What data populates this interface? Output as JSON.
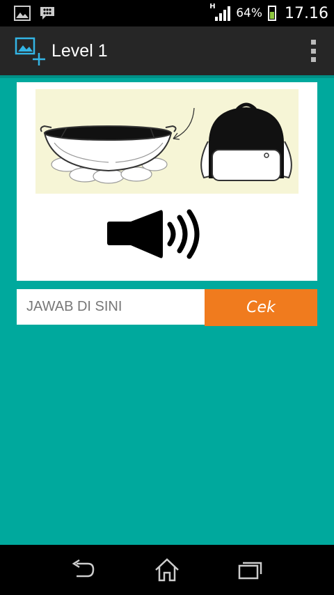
{
  "status_bar": {
    "network_type": "H",
    "battery_percent": "64%",
    "battery_level": 0.64,
    "time": "17.16"
  },
  "action_bar": {
    "title": "Level 1",
    "icon": "add-image-icon"
  },
  "puzzle": {
    "picture_icons": [
      "wok-icon",
      "backpack-icon"
    ],
    "audio_icon": "speaker-icon"
  },
  "answer": {
    "placeholder": "JAWAB DI SINI",
    "value": "",
    "check_label": "Cek"
  },
  "colors": {
    "background": "#00a99d",
    "button": "#f07b1e",
    "action_bar": "#262626"
  },
  "nav_bar": {
    "icons": [
      "back-icon",
      "home-icon",
      "recent-apps-icon"
    ]
  }
}
